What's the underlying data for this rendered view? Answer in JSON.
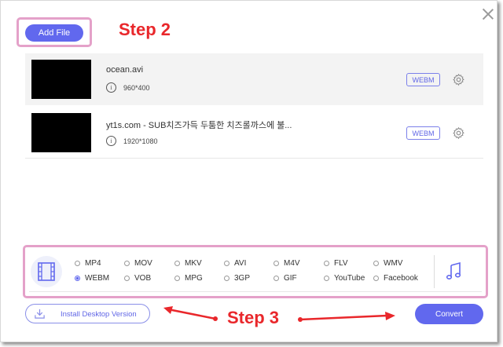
{
  "header": {
    "add_file_label": "Add File",
    "step2_label": "Step 2"
  },
  "files": [
    {
      "name": "ocean.avi",
      "resolution": "960*400",
      "format": "WEBM"
    },
    {
      "name": "yt1s.com - SUB치즈가득 두툼한 치즈롤까스에 불...",
      "resolution": "1920*1080",
      "format": "WEBM"
    }
  ],
  "formats": {
    "row1": [
      "MP4",
      "MOV",
      "MKV",
      "AVI",
      "M4V",
      "FLV",
      "WMV"
    ],
    "row2": [
      "WEBM",
      "VOB",
      "MPG",
      "3GP",
      "GIF",
      "YouTube",
      "Facebook"
    ],
    "selected": "WEBM"
  },
  "footer": {
    "install_label": "Install Desktop Version",
    "convert_label": "Convert",
    "step3_label": "Step 3"
  },
  "colors": {
    "accent": "#6168ee",
    "highlight": "#e4a1c9",
    "annotation": "#e9272b"
  },
  "icons": [
    "close-icon",
    "info-icon",
    "gear-icon",
    "film-icon",
    "music-icon",
    "download-icon"
  ]
}
